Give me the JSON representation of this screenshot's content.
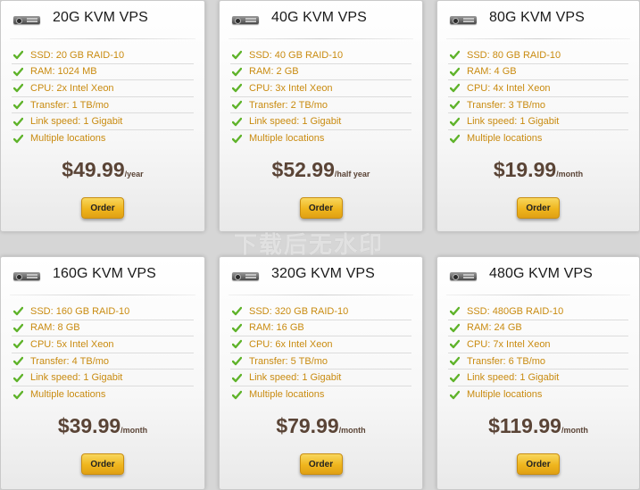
{
  "plans": [
    {
      "title": "20G KVM VPS",
      "features": [
        "SSD: 20 GB RAID-10",
        "RAM: 1024 MB",
        "CPU: 2x Intel Xeon",
        "Transfer: 1 TB/mo",
        "Link speed: 1 Gigabit",
        "Multiple locations"
      ],
      "price": "$49.99",
      "period": "/year",
      "button": "Order"
    },
    {
      "title": "40G KVM VPS",
      "features": [
        "SSD: 40 GB RAID-10",
        "RAM: 2 GB",
        "CPU: 3x Intel Xeon",
        "Transfer: 2 TB/mo",
        "Link speed: 1 Gigabit",
        "Multiple locations"
      ],
      "price": "$52.99",
      "period": "/half year",
      "button": "Order"
    },
    {
      "title": "80G KVM VPS",
      "features": [
        "SSD: 80 GB RAID-10",
        "RAM: 4 GB",
        "CPU: 4x Intel Xeon",
        "Transfer: 3 TB/mo",
        "Link speed: 1 Gigabit",
        "Multiple locations"
      ],
      "price": "$19.99",
      "period": "/month",
      "button": "Order"
    },
    {
      "title": "160G KVM VPS",
      "features": [
        "SSD: 160 GB RAID-10",
        "RAM: 8 GB",
        "CPU: 5x Intel Xeon",
        "Transfer: 4 TB/mo",
        "Link speed: 1 Gigabit",
        "Multiple locations"
      ],
      "price": "$39.99",
      "period": "/month",
      "button": "Order"
    },
    {
      "title": "320G KVM VPS",
      "features": [
        "SSD: 320 GB RAID-10",
        "RAM: 16 GB",
        "CPU: 6x Intel Xeon",
        "Transfer: 5 TB/mo",
        "Link speed: 1 Gigabit",
        "Multiple locations"
      ],
      "price": "$79.99",
      "period": "/month",
      "button": "Order"
    },
    {
      "title": "480G KVM VPS",
      "features": [
        "SSD: 480GB RAID-10",
        "RAM: 24 GB",
        "CPU: 7x Intel Xeon",
        "Transfer: 6 TB/mo",
        "Link speed: 1 Gigabit",
        "Multiple locations"
      ],
      "price": "$119.99",
      "period": "/month",
      "button": "Order"
    }
  ],
  "watermark": "下载后无水印",
  "colors": {
    "feature_text": "#c98b10",
    "price_text": "#5a4436",
    "check": "#5fb32a",
    "button": "#efb51d",
    "background": "#d6d6d6"
  },
  "icons": {
    "plan": "server-icon",
    "feature": "check-icon"
  }
}
